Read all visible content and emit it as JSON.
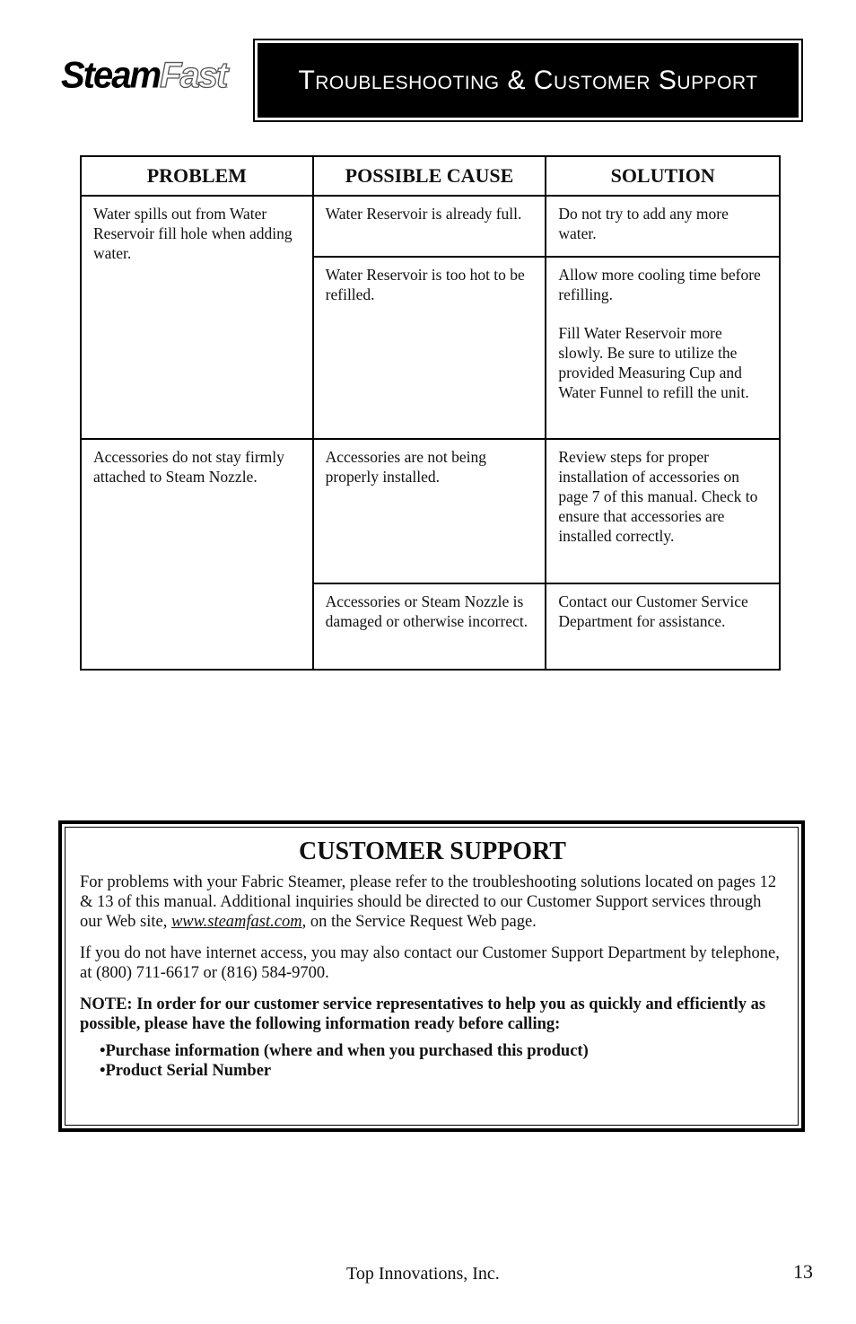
{
  "header": {
    "logo_part1": "Steam",
    "logo_part2": "Fast",
    "logo_mark": ".",
    "title": "Troubleshooting & Customer Support"
  },
  "table": {
    "headers": [
      "PROBLEM",
      "POSSIBLE CAUSE",
      "SOLUTION"
    ],
    "groups": [
      {
        "problem": "Water spills out from Water Reservoir fill hole when adding water.",
        "rows": [
          {
            "cause": "Water Reservoir is already full.",
            "solution": [
              "Do not try to add any more water."
            ]
          },
          {
            "cause": "Water Reservoir is too hot to be refilled.",
            "solution": [
              "Allow more cooling time before refilling.",
              "Fill Water Reservoir more slowly.  Be sure to utilize the provided Measuring Cup and Water Funnel to refill the unit."
            ]
          }
        ]
      },
      {
        "problem": "Accessories do not stay firmly attached to Steam Nozzle.",
        "rows": [
          {
            "cause": "Accessories are not being properly installed.",
            "solution": [
              "Review steps for proper installation of accessories on page 7 of this manual. Check to ensure that accessories are installed correctly."
            ]
          },
          {
            "cause": "Accessories or Steam Nozzle is damaged or otherwise incorrect.",
            "solution": [
              "Contact our Customer Service Department for assistance."
            ]
          }
        ]
      }
    ]
  },
  "customer_support": {
    "title": "CUSTOMER SUPPORT",
    "para1_before_link": "For problems with your Fabric Steamer, please refer to the troubleshooting solutions located on pages 12 & 13 of this manual.  Additional inquiries should be directed to our Customer Support services through our Web site, ",
    "link_text": "www.steamfast.com",
    "para1_after_link": ", on the Service Request Web page.",
    "para2": "If you do not have internet access, you may also contact our Customer Support Department by telephone, at (800) 711-6617 or (816) 584-9700.",
    "note": "NOTE: In order for our customer service representatives to help you as quickly and efficiently as possible, please have the following information ready before calling:",
    "items": [
      "Purchase information (where and when you purchased this product)",
      "Product Serial Number"
    ]
  },
  "footer": {
    "company": "Top Innovations, Inc.",
    "page_number": "13"
  }
}
